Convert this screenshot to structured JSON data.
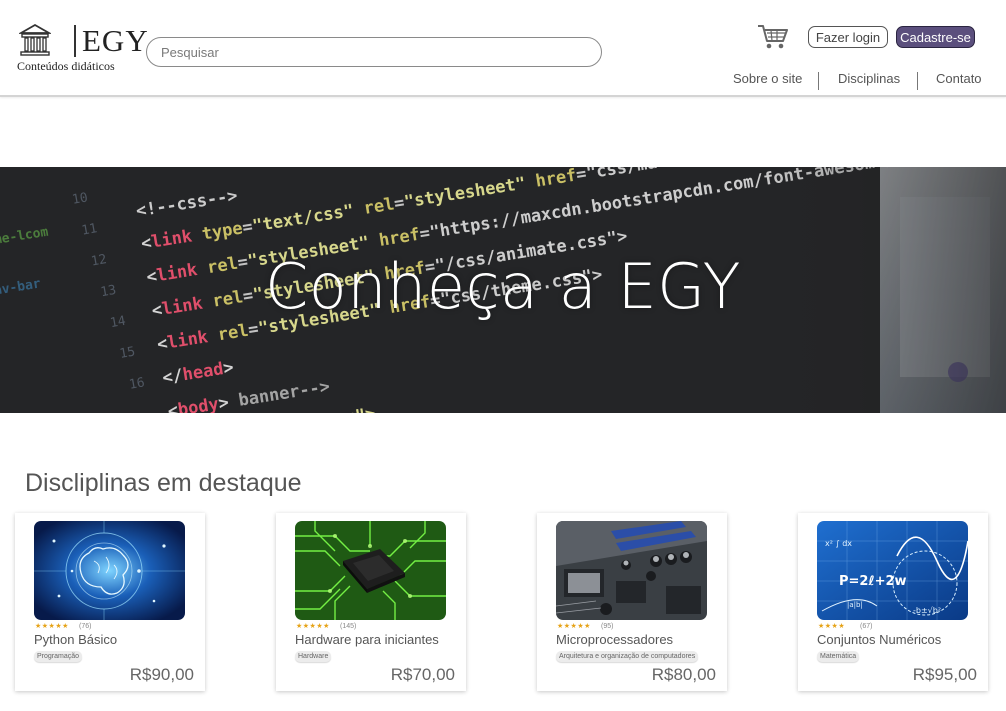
{
  "brand": {
    "name": "EGY",
    "tagline": "Conteúdos didáticos"
  },
  "search": {
    "placeholder": "Pesquisar"
  },
  "header": {
    "cart_icon": "shopping-cart-icon",
    "login_label": "Fazer login",
    "signup_label": "Cadastre-se"
  },
  "nav": {
    "items": [
      {
        "label": "Sobre o site"
      },
      {
        "label": "Disciplinas"
      },
      {
        "label": "Contato"
      }
    ]
  },
  "hero": {
    "title": "Conheça a EGY"
  },
  "featured": {
    "title": "Discliplinas em destaque",
    "courses": [
      {
        "title": "Python Básico",
        "rating": 4.5,
        "reviews": "(76)",
        "stars": "★★★★★",
        "category": "Programação",
        "price": "R$90,00"
      },
      {
        "title": "Hardware para iniciantes",
        "rating": 5,
        "reviews": "(145)",
        "stars": "★★★★★",
        "category": "Hardware",
        "price": "R$70,00"
      },
      {
        "title": "Microprocessadores",
        "rating": 4.5,
        "reviews": "(95)",
        "stars": "★★★★★",
        "category": "Arquitetura e organização de computadores",
        "price": "R$80,00"
      },
      {
        "title": "Conjuntos Numéricos",
        "rating": 4,
        "reviews": "(67)",
        "stars": "★★★★",
        "category": "Matemática",
        "price": "R$95,00"
      }
    ]
  },
  "colors": {
    "accent": "#5b4f7d",
    "star": "#e6a318",
    "hero_bg": "#2b2c2e"
  }
}
